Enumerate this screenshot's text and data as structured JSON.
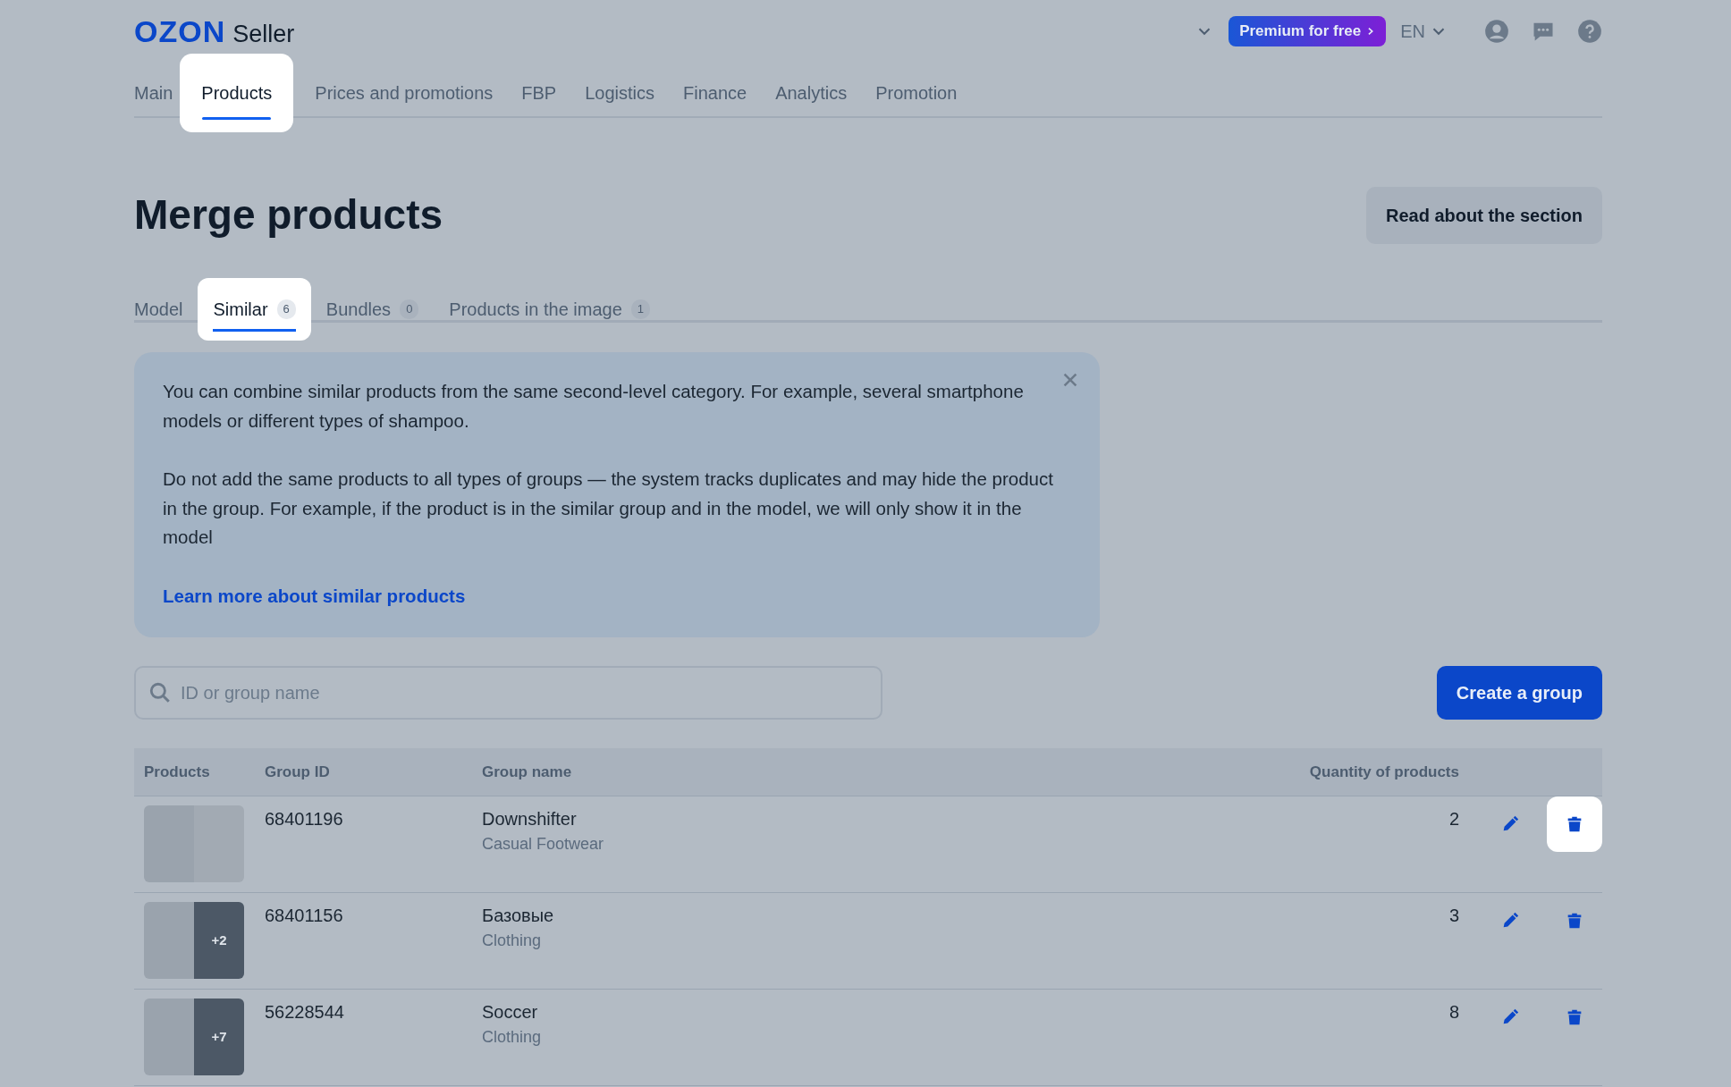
{
  "header": {
    "logo": "OZON",
    "logo_suffix": "Seller",
    "premium": "Premium for free",
    "language": "EN"
  },
  "nav": [
    {
      "label": "Main",
      "selected": false
    },
    {
      "label": "Products",
      "selected": true
    },
    {
      "label": "Prices and promotions",
      "selected": false
    },
    {
      "label": "FBP",
      "selected": false
    },
    {
      "label": "Logistics",
      "selected": false
    },
    {
      "label": "Finance",
      "selected": false
    },
    {
      "label": "Analytics",
      "selected": false
    },
    {
      "label": "Promotion",
      "selected": false
    }
  ],
  "page_title": "Merge products",
  "read_button": "Read about the section",
  "tabs": [
    {
      "label": "Model",
      "selected": false
    },
    {
      "label": "Similar",
      "count": "6",
      "selected": true
    },
    {
      "label": "Bundles",
      "count": "0",
      "selected": false
    },
    {
      "label": "Products in the image",
      "count": "1",
      "selected": false
    }
  ],
  "info": {
    "paragraphs": [
      "You can combine similar products from the same second-level category. For example, several smartphone models or different types of shampoo.",
      "Do not add the same products to all types of groups — the system tracks duplicates and may hide the product in the group. For example, if the product is in the similar group and in the model, we will only show it in the model"
    ],
    "link": "Learn more about similar products"
  },
  "search": {
    "placeholder": "ID or group name"
  },
  "create_button": "Create a group",
  "table": {
    "columns": [
      "Products",
      "Group ID",
      "Group name",
      "Quantity of products"
    ],
    "rows": [
      {
        "group_id": "68401196",
        "name": "Downshifter",
        "category": "Casual Footwear",
        "quantity": "2",
        "delete_highlighted": true
      },
      {
        "group_id": "68401156",
        "name": "Базовые",
        "category": "Clothing",
        "quantity": "3",
        "more": "+2",
        "delete_highlighted": false
      },
      {
        "group_id": "56228544",
        "name": "Soccer",
        "category": "Clothing",
        "quantity": "8",
        "more": "+7",
        "delete_highlighted": false
      }
    ]
  }
}
